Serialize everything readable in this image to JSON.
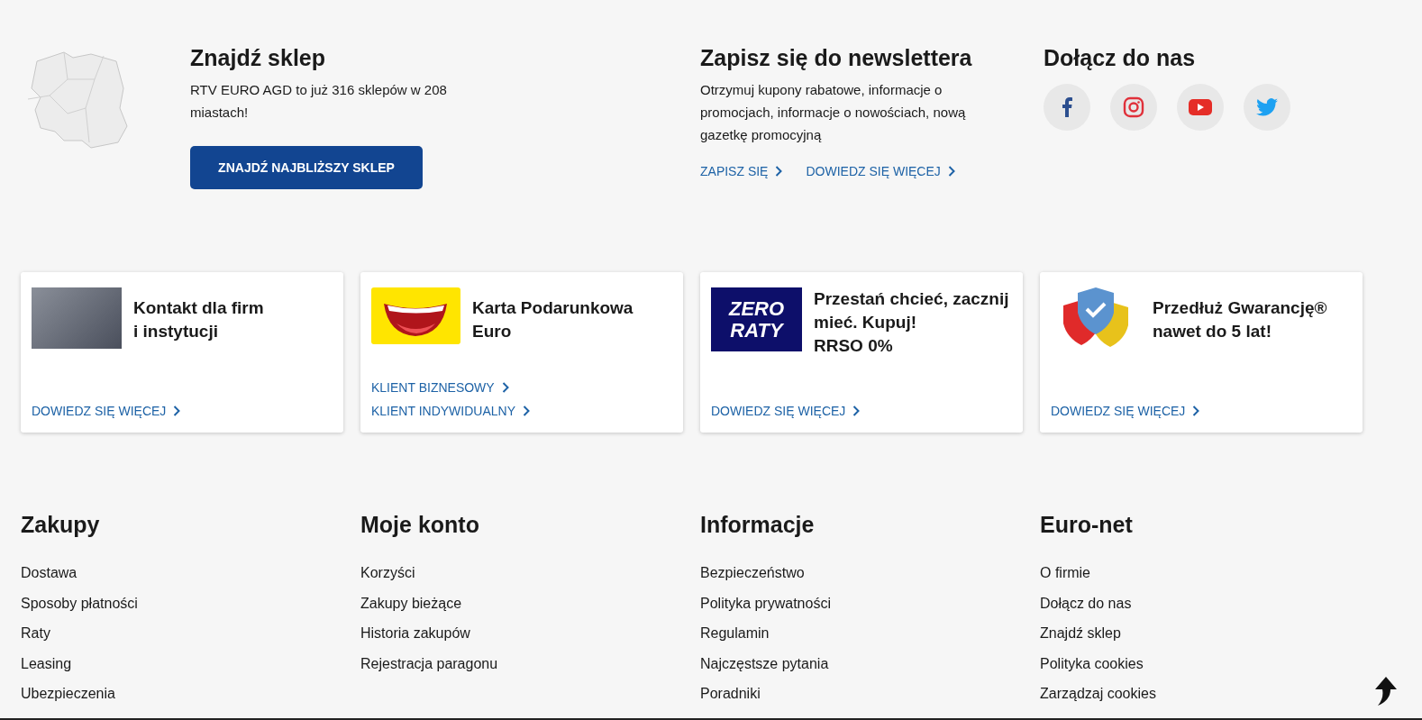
{
  "store": {
    "title": "Znajdź sklep",
    "text": "RTV EURO AGD to już 316 sklepów w 208 miastach!",
    "button": "ZNAJDŹ NAJBLIŻSZY SKLEP"
  },
  "newsletter": {
    "title": "Zapisz się do newslettera",
    "text": "Otrzymuj kupony rabatowe, informacje o promocjach, informacje o nowościach, nową gazetkę promocyjną",
    "links": [
      "ZAPISZ SIĘ",
      "DOWIEDZ SIĘ WIĘCEJ"
    ]
  },
  "social": {
    "title": "Dołącz do nas",
    "icons": [
      {
        "kind": "facebook"
      },
      {
        "kind": "instagram"
      },
      {
        "kind": "youtube"
      },
      {
        "kind": "twitter"
      }
    ]
  },
  "cards": [
    {
      "kind": "photo",
      "title": "Kontakt dla firm\ni instytucji",
      "links": [
        "DOWIEDZ SIĘ WIĘCEJ"
      ]
    },
    {
      "kind": "giftcard",
      "title": "Karta Podarunkowa\nEuro",
      "links": [
        "KLIENT BIZNESOWY",
        "KLIENT INDYWIDUALNY"
      ]
    },
    {
      "kind": "zero",
      "logo_text": [
        "ZERO",
        "RATY"
      ],
      "title": "Przestań chcieć, zacznij\nmieć. Kupuj!\nRRSO 0%",
      "links": [
        "DOWIEDZ SIĘ WIĘCEJ"
      ]
    },
    {
      "kind": "shield",
      "title": "Przedłuż Gwarancję®\nnawet do 5 lat!",
      "links": [
        "DOWIEDZ SIĘ WIĘCEJ"
      ]
    }
  ],
  "footer_columns": [
    {
      "title": "Zakupy",
      "items": [
        "Dostawa",
        "Sposoby płatności",
        "Raty",
        "Leasing",
        "Ubezpieczenia"
      ]
    },
    {
      "title": "Moje konto",
      "items": [
        "Korzyści",
        "Zakupy bieżące",
        "Historia zakupów",
        "Rejestracja paragonu"
      ]
    },
    {
      "title": "Informacje",
      "items": [
        "Bezpieczeństwo",
        "Polityka prywatności",
        "Regulamin",
        "Najczęstsze pytania",
        "Poradniki"
      ]
    },
    {
      "title": "Euro-net",
      "items": [
        "O firmie",
        "Dołącz do nas",
        "Znajdź sklep",
        "Polityka cookies",
        "Zarządzaj cookies"
      ]
    }
  ]
}
